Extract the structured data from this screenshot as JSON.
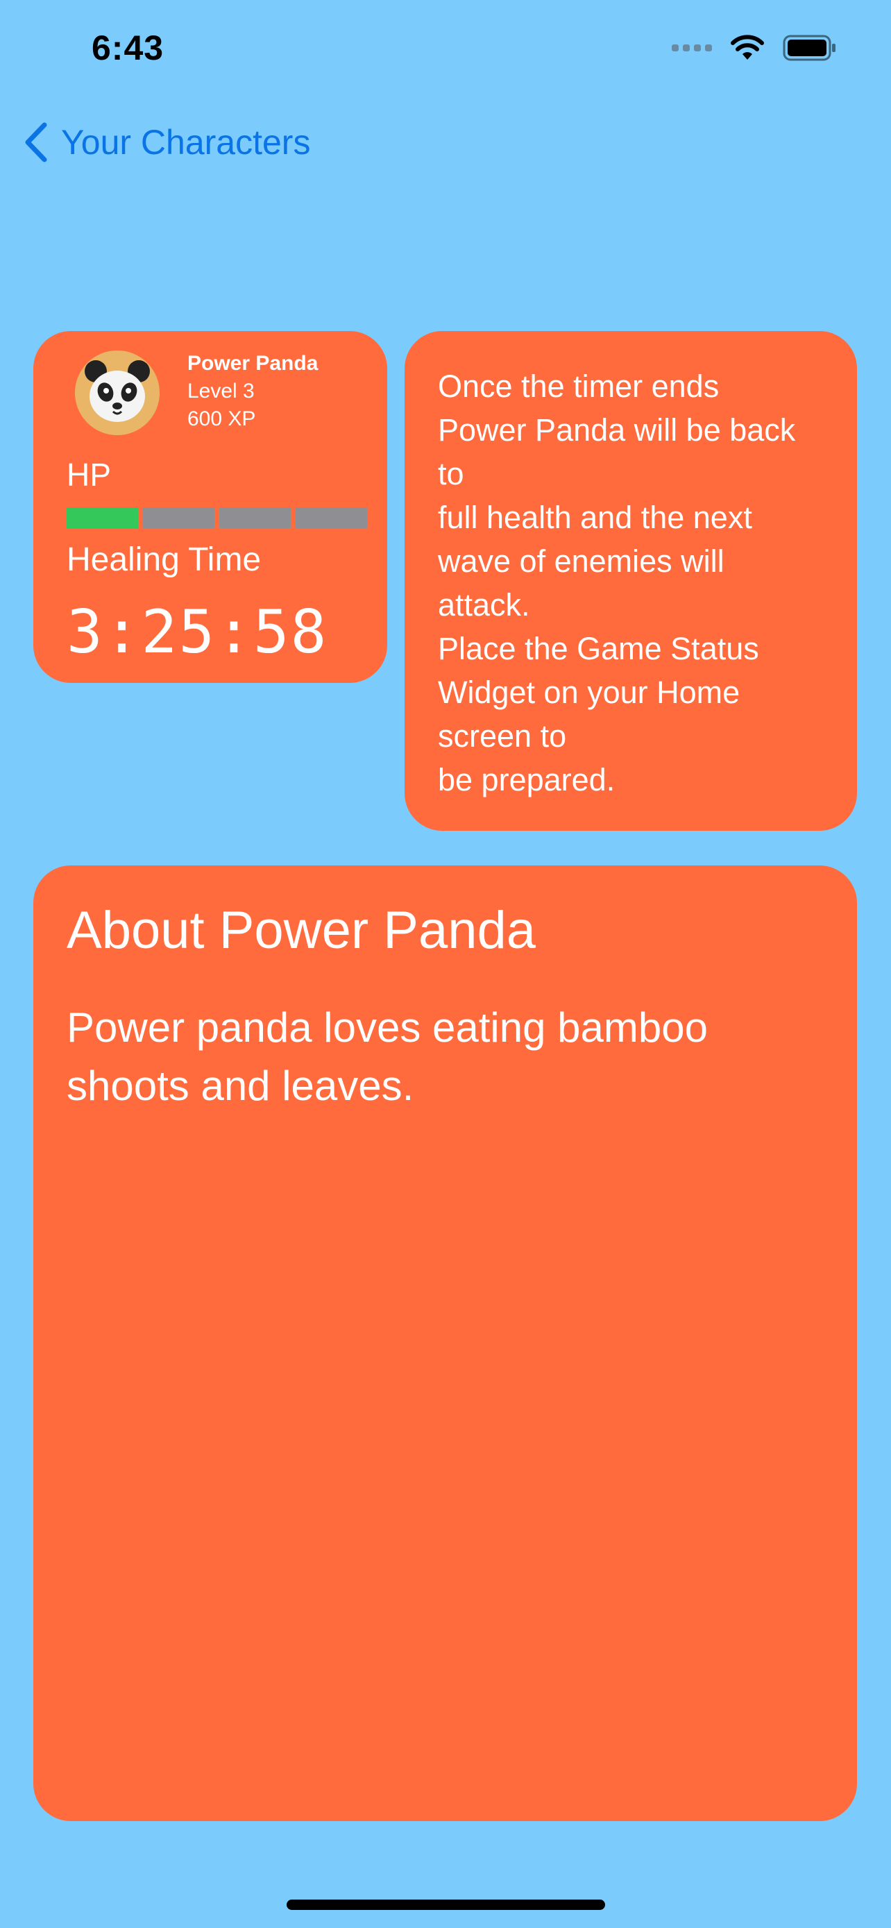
{
  "status_bar": {
    "time": "6:43"
  },
  "nav": {
    "back_label": "Your Characters"
  },
  "character": {
    "name": "Power Panda",
    "level": "Level 3",
    "xp": "600 XP",
    "avatar_icon": "panda-emoji",
    "hp_label": "HP",
    "hp": {
      "filled_segments": 1,
      "total_segments": 4
    },
    "healing_label": "Healing Time",
    "healing_time": "3:25:58"
  },
  "info": {
    "lines": [
      "Once the timer ends",
      "Power Panda will be back",
      "to",
      "full health and the next",
      "wave of enemies will",
      "attack.",
      "Place the Game Status",
      "Widget on your Home",
      "screen to",
      "be prepared."
    ]
  },
  "about": {
    "title": "About Power Panda",
    "description": "Power panda loves eating bamboo shoots and leaves."
  },
  "colors": {
    "background": "#7BCBFC",
    "card": "#FF6B3D",
    "accent": "#0A73E6",
    "hp_filled": "#34C759",
    "hp_empty": "#8E8E93"
  }
}
